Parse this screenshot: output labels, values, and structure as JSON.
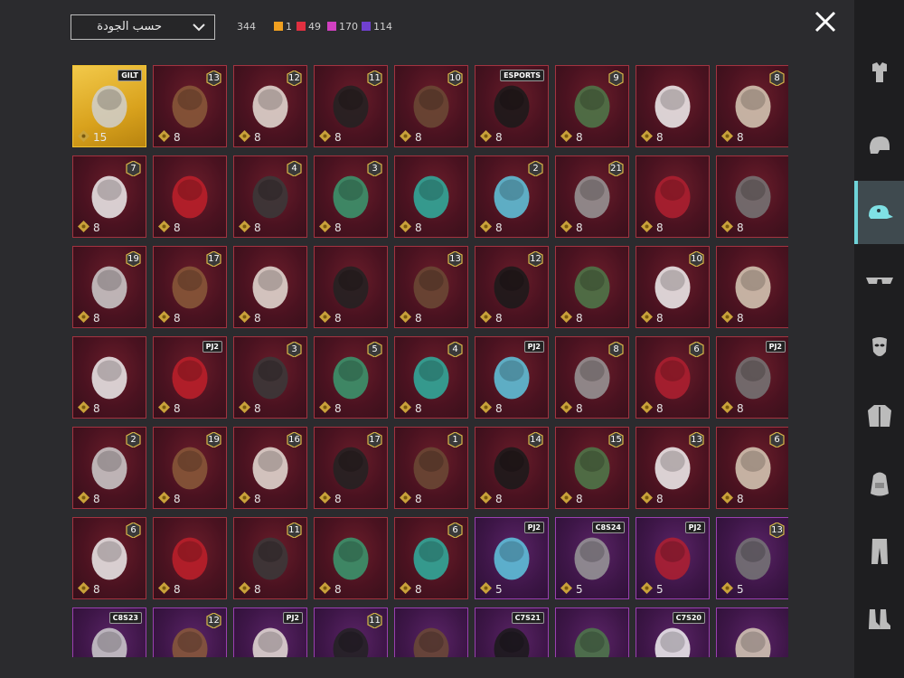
{
  "header": {
    "sort_label": "حسب الجودة",
    "total": "344",
    "stats": [
      {
        "value": "1",
        "color": "#f0a020"
      },
      {
        "value": "49",
        "color": "#e03040"
      },
      {
        "value": "170",
        "color": "#d040c0"
      },
      {
        "value": "114",
        "color": "#7040d0"
      }
    ]
  },
  "sidebar": {
    "tabs": [
      {
        "icon": "outfit-icon"
      },
      {
        "icon": "helmet-icon"
      },
      {
        "icon": "cap-icon",
        "active": true
      },
      {
        "icon": "glasses-icon"
      },
      {
        "icon": "mask-icon"
      },
      {
        "icon": "jacket-icon"
      },
      {
        "icon": "backpack-icon"
      },
      {
        "icon": "pants-icon"
      },
      {
        "icon": "shoes-icon"
      }
    ]
  },
  "grid": {
    "items": [
      {
        "count": "15",
        "rarity": "gold",
        "tag": "GILT"
      },
      {
        "count": "8",
        "rarity": "red",
        "level": "13"
      },
      {
        "count": "8",
        "rarity": "red",
        "level": "12"
      },
      {
        "count": "8",
        "rarity": "red",
        "level": "11"
      },
      {
        "count": "8",
        "rarity": "red",
        "level": "10"
      },
      {
        "count": "8",
        "rarity": "red",
        "tag": "ESPORTS"
      },
      {
        "count": "8",
        "rarity": "red",
        "level": "9"
      },
      {
        "count": "8",
        "rarity": "red"
      },
      {
        "count": "8",
        "rarity": "red",
        "level": "8"
      },
      {
        "count": "8",
        "rarity": "red",
        "level": "7"
      },
      {
        "count": "8",
        "rarity": "red"
      },
      {
        "count": "8",
        "rarity": "red",
        "level": "4"
      },
      {
        "count": "8",
        "rarity": "red",
        "level": "3"
      },
      {
        "count": "8",
        "rarity": "red"
      },
      {
        "count": "8",
        "rarity": "red",
        "level": "2"
      },
      {
        "count": "8",
        "rarity": "red",
        "level": "21"
      },
      {
        "count": "8",
        "rarity": "red"
      },
      {
        "count": "8",
        "rarity": "red"
      },
      {
        "count": "8",
        "rarity": "red",
        "level": "19"
      },
      {
        "count": "8",
        "rarity": "red",
        "level": "17"
      },
      {
        "count": "8",
        "rarity": "red"
      },
      {
        "count": "8",
        "rarity": "red"
      },
      {
        "count": "8",
        "rarity": "red",
        "level": "13"
      },
      {
        "count": "8",
        "rarity": "red",
        "level": "12"
      },
      {
        "count": "8",
        "rarity": "red"
      },
      {
        "count": "8",
        "rarity": "red",
        "level": "10"
      },
      {
        "count": "8",
        "rarity": "red"
      },
      {
        "count": "8",
        "rarity": "red"
      },
      {
        "count": "8",
        "rarity": "red",
        "tag": "PJ2"
      },
      {
        "count": "8",
        "rarity": "red",
        "level": "3"
      },
      {
        "count": "8",
        "rarity": "red",
        "level": "5"
      },
      {
        "count": "8",
        "rarity": "red",
        "level": "4"
      },
      {
        "count": "8",
        "rarity": "red",
        "tag": "PJ2"
      },
      {
        "count": "8",
        "rarity": "red",
        "level": "8"
      },
      {
        "count": "8",
        "rarity": "red",
        "level": "6"
      },
      {
        "count": "8",
        "rarity": "red",
        "tag": "PJ2"
      },
      {
        "count": "8",
        "rarity": "red",
        "level": "2"
      },
      {
        "count": "8",
        "rarity": "red",
        "level": "19"
      },
      {
        "count": "8",
        "rarity": "red",
        "level": "16"
      },
      {
        "count": "8",
        "rarity": "red",
        "level": "17"
      },
      {
        "count": "8",
        "rarity": "red",
        "level": "1"
      },
      {
        "count": "8",
        "rarity": "red",
        "level": "14"
      },
      {
        "count": "8",
        "rarity": "red",
        "level": "15"
      },
      {
        "count": "8",
        "rarity": "red",
        "level": "13"
      },
      {
        "count": "8",
        "rarity": "red",
        "level": "6"
      },
      {
        "count": "8",
        "rarity": "red",
        "level": "6"
      },
      {
        "count": "8",
        "rarity": "red"
      },
      {
        "count": "8",
        "rarity": "red",
        "level": "11"
      },
      {
        "count": "8",
        "rarity": "red"
      },
      {
        "count": "8",
        "rarity": "red",
        "level": "6"
      },
      {
        "count": "5",
        "rarity": "purple",
        "tag": "PJ2"
      },
      {
        "count": "5",
        "rarity": "purple",
        "tag": "C8S24"
      },
      {
        "count": "5",
        "rarity": "purple",
        "tag": "PJ2"
      },
      {
        "count": "5",
        "rarity": "purple",
        "level": "13"
      },
      {
        "count": "",
        "rarity": "purple",
        "tag": "C8S23"
      },
      {
        "count": "",
        "rarity": "purple",
        "level": "12"
      },
      {
        "count": "",
        "rarity": "purple",
        "tag": "PJ2"
      },
      {
        "count": "",
        "rarity": "purple",
        "level": "11"
      },
      {
        "count": "",
        "rarity": "purple"
      },
      {
        "count": "",
        "rarity": "purple",
        "tag": "C7S21"
      },
      {
        "count": "",
        "rarity": "purple"
      },
      {
        "count": "",
        "rarity": "purple",
        "tag": "C7S20"
      },
      {
        "count": "",
        "rarity": "purple"
      }
    ]
  }
}
